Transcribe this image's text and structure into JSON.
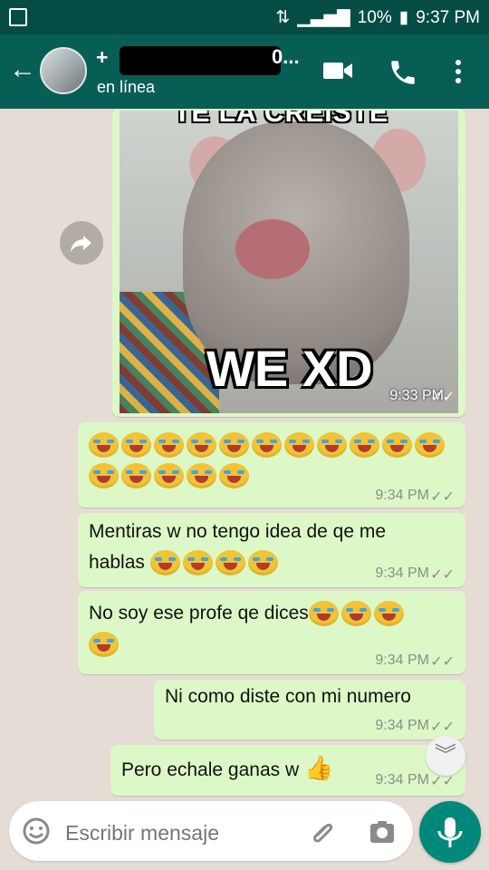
{
  "status_bar": {
    "battery": "10%",
    "time": "9:37 PM"
  },
  "header": {
    "contact_name": "+",
    "contact_suffix": "0...",
    "presence": "en línea"
  },
  "meme_image": {
    "top_text": "TE LA CREISTE",
    "bottom_text": "WE XD",
    "time": "9:33 PM"
  },
  "messages": [
    {
      "text": "",
      "emoji_count": 16,
      "time": "9:34 PM"
    },
    {
      "text": "Mentiras w no tengo idea de qe me hablas",
      "emoji_count": 4,
      "time": "9:34 PM"
    },
    {
      "text": "No soy ese profe qe dices",
      "emoji_count": 4,
      "time": "9:34 PM"
    },
    {
      "text": "Ni como diste con mi numero",
      "emoji_count": 0,
      "time": "9:34 PM"
    },
    {
      "text": "Pero echale ganas w",
      "emoji": "thumbs-up",
      "time": "9:34 PM"
    }
  ],
  "input": {
    "placeholder": "Escribir mensaje"
  }
}
